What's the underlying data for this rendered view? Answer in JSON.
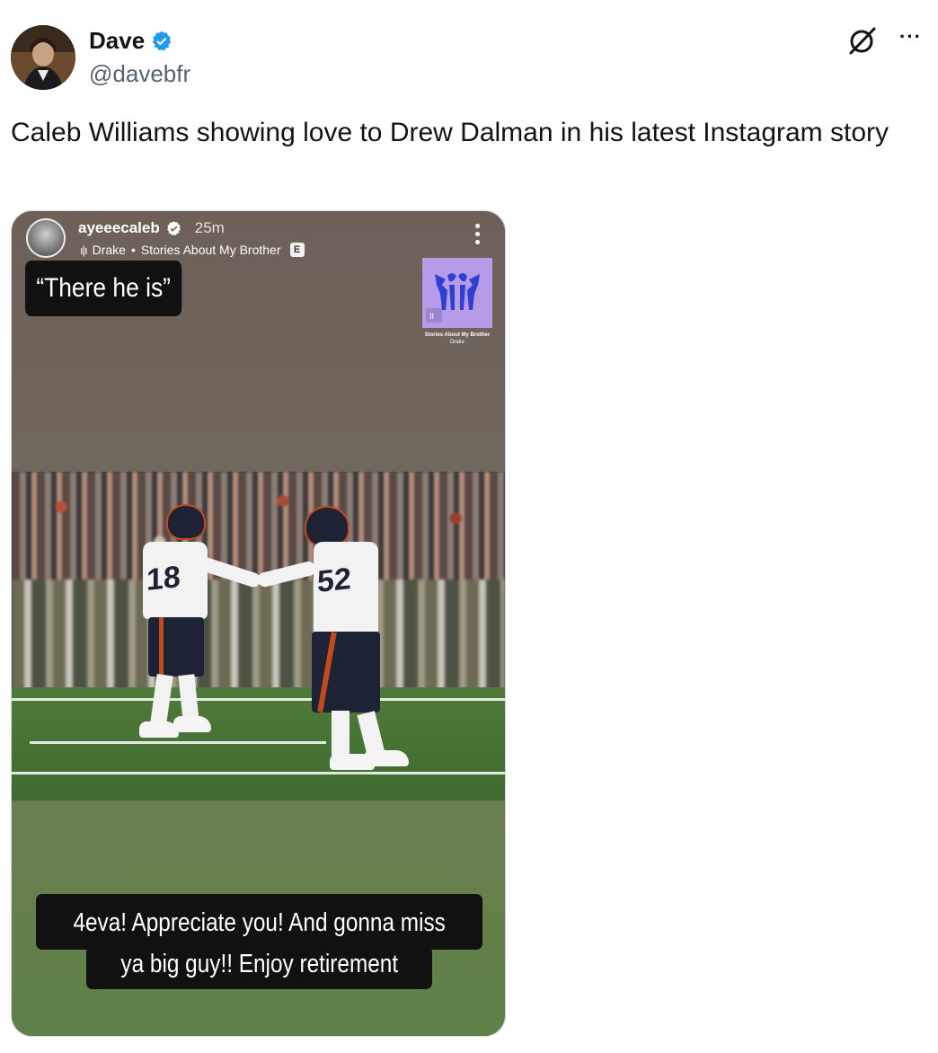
{
  "tweet": {
    "display_name": "Dave",
    "handle": "@davebfr",
    "verified_icon": "verified-badge-icon",
    "text": "Caleb Williams showing love to Drew Dalman in his latest Instagram story",
    "actions": {
      "grok_icon": "grok-icon",
      "more_icon": "more-icon",
      "more_label": "···"
    }
  },
  "story": {
    "username": "ayeeecaleb",
    "time": "25m",
    "music": {
      "artist": "Drake",
      "separator": "•",
      "song": "Stories About My Brother",
      "explicit": "E",
      "bars": "ı|ı"
    },
    "caption_top": "“There he is”",
    "sticker": {
      "title": "Stories About My Brother",
      "artist": "Drake",
      "play_glyph": "II"
    },
    "caption_bottom_line1": "4eva! Appreciate you! And gonna miss",
    "caption_bottom_line2": "ya big guy!! Enjoy retirement",
    "photo": {
      "jersey_left": "18",
      "jersey_right": "52"
    }
  },
  "colors": {
    "text_primary": "#0f1419",
    "text_secondary": "#536471",
    "verified_blue": "#1d9bf0",
    "story_bg_top": "#6e5f59",
    "story_bg_bottom": "#5f8048",
    "sticker_purple": "#b69ce8",
    "bears_navy": "#1d2235",
    "bears_orange": "#c24a1c"
  }
}
